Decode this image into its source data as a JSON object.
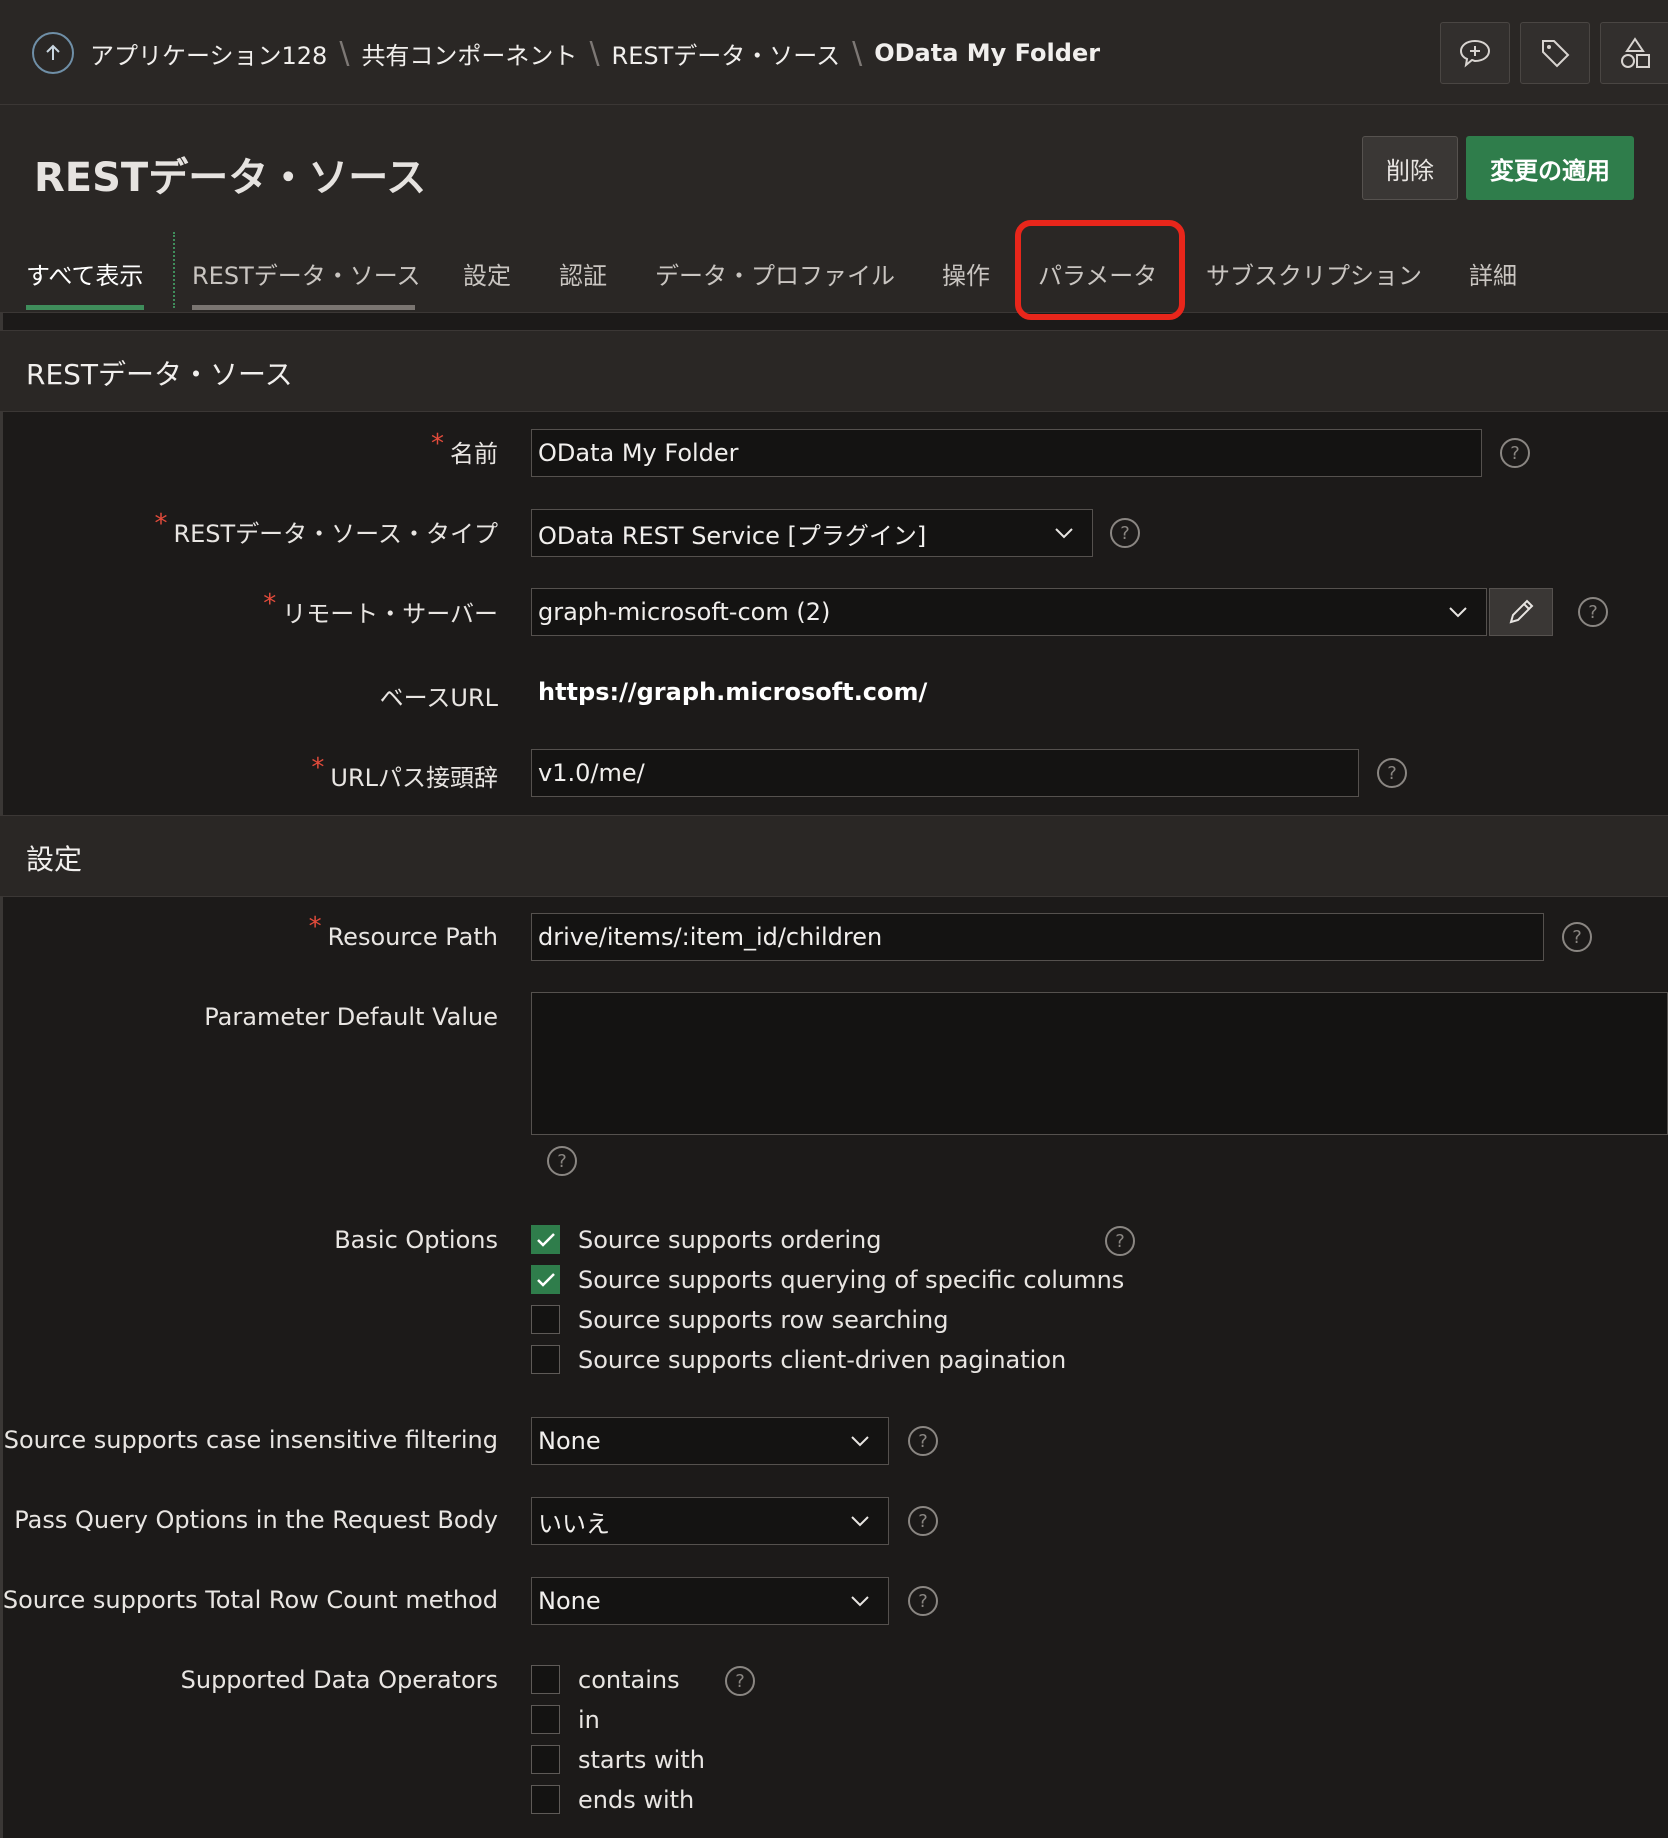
{
  "breadcrumb": {
    "items": [
      "アプリケーション128",
      "共有コンポーネント",
      "RESTデータ・ソース"
    ],
    "current": "OData My Folder"
  },
  "header": {
    "title": "RESTデータ・ソース",
    "delete_label": "削除",
    "apply_label": "変更の適用"
  },
  "tabs": [
    "すべて表示",
    "RESTデータ・ソース",
    "設定",
    "認証",
    "データ・プロファイル",
    "操作",
    "パラメータ",
    "サブスクリプション",
    "詳細"
  ],
  "sections": {
    "rest": {
      "title": "RESTデータ・ソース",
      "name_label": "名前",
      "name_value": "OData My Folder",
      "type_label": "RESTデータ・ソース・タイプ",
      "type_value": "OData REST Service [プラグイン]",
      "server_label": "リモート・サーバー",
      "server_value": "graph-microsoft-com (2)",
      "base_url_label": "ベースURL",
      "base_url_value": "https://graph.microsoft.com/",
      "prefix_label": "URLパス接頭辞",
      "prefix_value": "v1.0/me/"
    },
    "settings": {
      "title": "設定",
      "resource_path_label": "Resource Path",
      "resource_path_value": "drive/items/:item_id/children",
      "param_default_label": "Parameter Default Value",
      "param_default_value": "",
      "basic_options_label": "Basic Options",
      "basic_options": [
        {
          "label": "Source supports ordering",
          "checked": true
        },
        {
          "label": "Source supports querying of specific columns",
          "checked": true
        },
        {
          "label": "Source supports row searching",
          "checked": false
        },
        {
          "label": "Source supports client-driven pagination",
          "checked": false
        }
      ],
      "case_label": "Source supports case insensitive filtering",
      "case_value": "None",
      "query_body_label": "Pass Query Options in the Request Body",
      "query_body_value": "いいえ",
      "total_count_label": "Source supports Total Row Count method",
      "total_count_value": "None",
      "operators_label": "Supported Data Operators",
      "operators": [
        {
          "label": "contains",
          "checked": false
        },
        {
          "label": "in",
          "checked": false
        },
        {
          "label": "starts with",
          "checked": false
        },
        {
          "label": "ends with",
          "checked": false
        }
      ]
    }
  },
  "help_glyph": "?",
  "colors": {
    "accent_green": "#2f7d4b",
    "highlight_red": "#e8261b",
    "required_red": "#e24b3b"
  }
}
